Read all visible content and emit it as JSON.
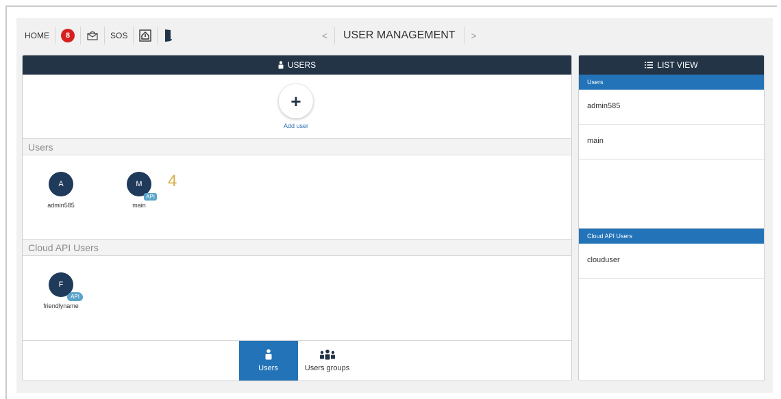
{
  "topbar": {
    "home_label": "HOME",
    "notification_count": "8",
    "sos_label": "SOS",
    "page_title": "USER MANAGEMENT",
    "prev_arrow": "<",
    "next_arrow": ">"
  },
  "users_panel": {
    "header_label": "USERS",
    "add_label": "Add user",
    "users_section_title": "Users",
    "users": [
      {
        "initial": "A",
        "name": "admin585",
        "api": false
      },
      {
        "initial": "M",
        "name": "main",
        "api": true
      }
    ],
    "api_tag_label": "API",
    "users_count": "4",
    "cloud_section_title": "Cloud API Users",
    "cloud_users": [
      {
        "initial": "F",
        "name": "friendlyname"
      }
    ],
    "tabs": [
      {
        "label": "Users",
        "active": true
      },
      {
        "label": "Users groups",
        "active": false
      }
    ]
  },
  "list_view": {
    "header_label": "LIST VIEW",
    "users_sub_header": "Users",
    "users_rows": [
      "admin585",
      "main"
    ],
    "cloud_sub_header": "Cloud API Users",
    "cloud_rows": [
      "clouduser"
    ]
  },
  "colors": {
    "header_dark": "#243447",
    "accent_blue": "#2373b8",
    "badge_red": "#d62020",
    "count_gold": "#d4b24a"
  }
}
